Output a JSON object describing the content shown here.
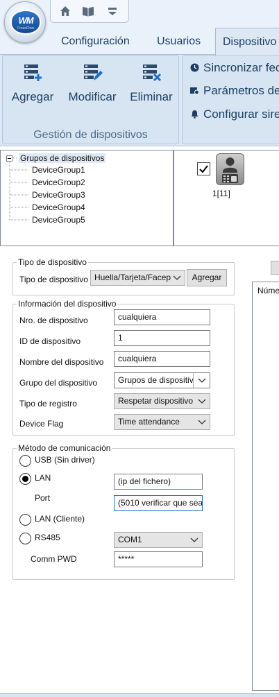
{
  "app": {
    "logo_text": "WM",
    "logo_subtext": "CrossChex"
  },
  "quick_access": {
    "icons": [
      "home-icon",
      "book-icon",
      "dropdown-icon"
    ]
  },
  "tabs": [
    {
      "label": "Configuración"
    },
    {
      "label": "Usuarios"
    },
    {
      "label": "Dispositivo"
    }
  ],
  "ribbon": {
    "device_management": {
      "add": "Agregar",
      "modify": "Modificar",
      "delete": "Eliminar",
      "caption": "Gestión de dispositivos"
    },
    "side_items": [
      {
        "label": "Sincronizar fec",
        "icon": "clock-icon"
      },
      {
        "label": "Parámetros de",
        "icon": "settings-icon"
      },
      {
        "label": "Configurar sire",
        "icon": "bell-icon"
      }
    ]
  },
  "tree": {
    "root": "Grupos de dispositivos",
    "groups": [
      "DeviceGroup1",
      "DeviceGroup2",
      "DeviceGroup3",
      "DeviceGroup4",
      "DeviceGroup5"
    ]
  },
  "devices": [
    {
      "label": "1[11]",
      "checked": true
    }
  ],
  "device_type": {
    "legend": "Tipo de dispositivo",
    "label": "Tipo de dispositivo",
    "value": "Huella/Tarjeta/Facep",
    "add_button": "Agregar"
  },
  "device_info": {
    "legend": "Información del dispositivo",
    "fields": [
      {
        "label": "Nro. de dispositivo",
        "value": "cualquiera"
      },
      {
        "label": "ID de dispositivo",
        "value": "1"
      },
      {
        "label": "Nombre del dispositivo",
        "value": "cualquiera"
      },
      {
        "label": "Grupo del dispositivo",
        "value": "Grupos de dispositiv"
      },
      {
        "label": "Tipo de registro",
        "value": "Respetar dispositivo"
      },
      {
        "label": "Device Flag",
        "value": "Time attendance"
      }
    ]
  },
  "communication": {
    "legend": "Método de comunicación",
    "usb_label": "USB (Sin driver)",
    "lan_label": "LAN",
    "lan_value": "(ip del fichero)",
    "port_label": "Port",
    "port_value": "(5010 verificar que sea)",
    "lan_client_label": "LAN (Cliente)",
    "rs485_label": "RS485",
    "rs485_value": "COM1",
    "pwd_label": "Comm PWD",
    "pwd_value": "*****",
    "selected": "LAN"
  },
  "right_list": {
    "column_header": "Núme"
  }
}
